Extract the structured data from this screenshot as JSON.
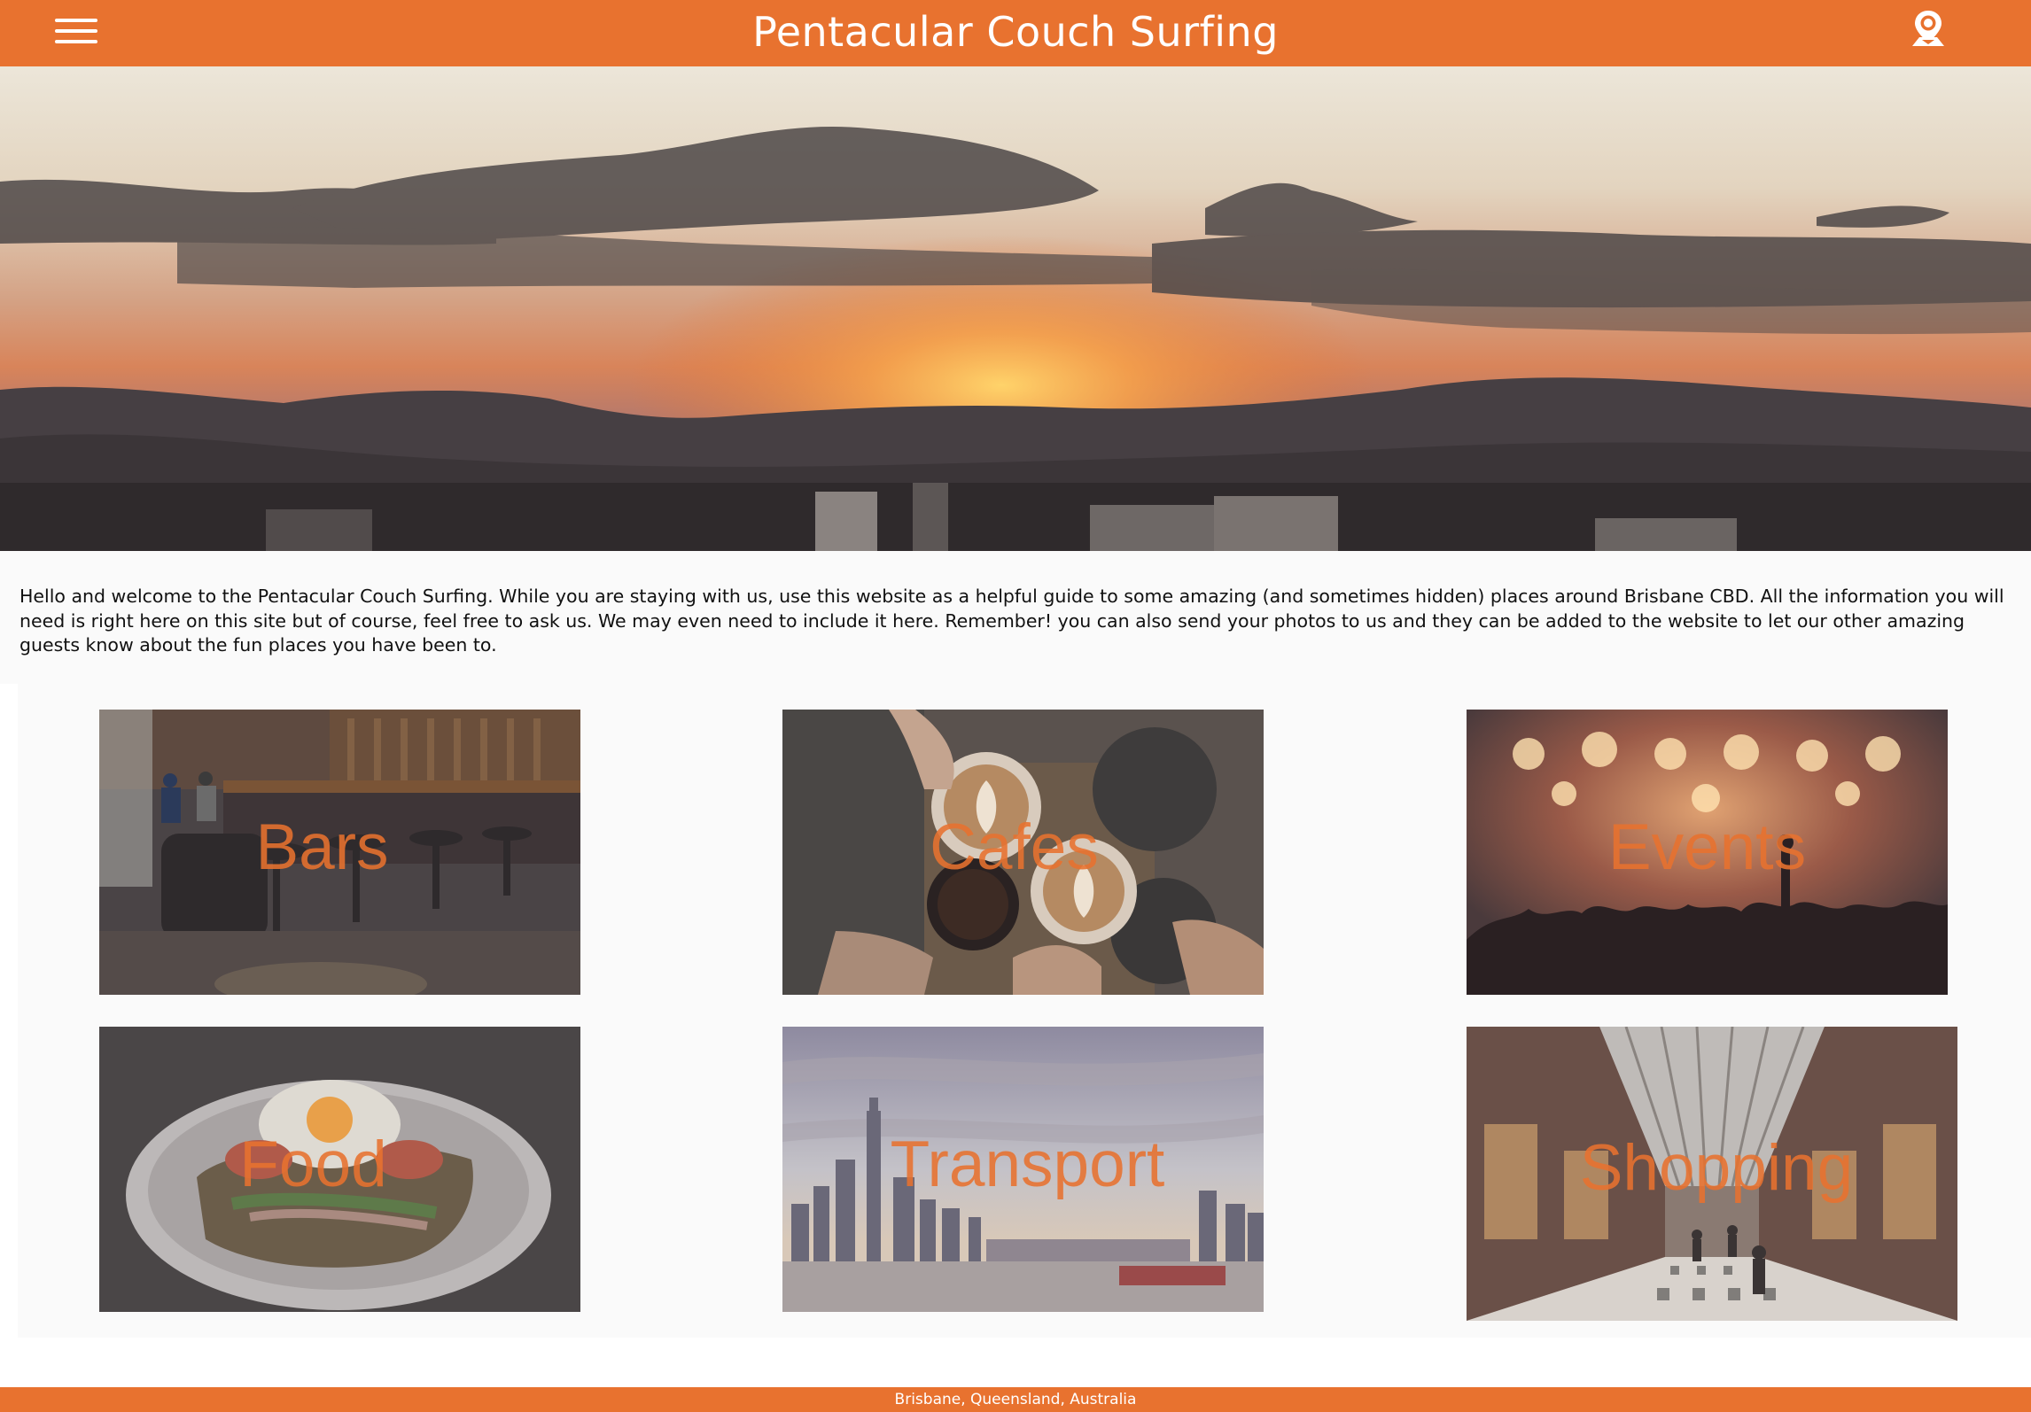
{
  "header": {
    "title": "Pentacular Couch Surfing",
    "menu_icon": "hamburger-menu-icon",
    "location_icon": "map-pin-icon"
  },
  "hero": {
    "image": "sunset-over-brisbane-skyline"
  },
  "intro": {
    "text": "Hello and welcome to the Pentacular Couch Surfing. While you are staying with us, use this website as a helpful guide to some amazing (and sometimes hidden) places around Brisbane CBD. All the information you will need is right here on this site but of course, feel free to ask us. We may even need to include it here. Remember! you can also send your photos to us and they can be added to the website to let our other amazing guests know about the fun places you have been to."
  },
  "categories": [
    {
      "label": "Bars",
      "image": "bar-interior-photo"
    },
    {
      "label": "Cafes",
      "image": "coffee-cups-photo"
    },
    {
      "label": "Events",
      "image": "concert-crowd-photo"
    },
    {
      "label": "Food",
      "image": "egg-toast-plate-photo"
    },
    {
      "label": "Transport",
      "image": "city-skyline-river-photo"
    },
    {
      "label": "Shopping",
      "image": "shopping-arcade-photo"
    }
  ],
  "footer": {
    "text": "Brisbane, Queensland, Australia"
  },
  "colors": {
    "brand": "#e8722f",
    "background": "#fafafa"
  }
}
